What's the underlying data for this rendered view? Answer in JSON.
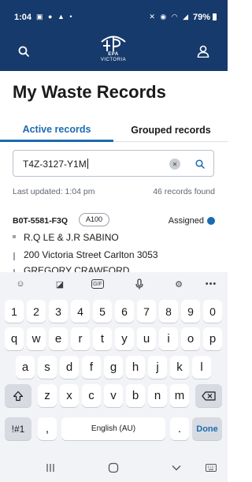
{
  "status_bar": {
    "time": "1:04",
    "battery": "79%",
    "left_icons": [
      "gallery-icon",
      "info-icon",
      "alert-icon",
      "dot-icon"
    ],
    "right_icons": [
      "mute-icon",
      "location-icon",
      "wifi-icon",
      "signal-icon"
    ]
  },
  "header": {
    "logo_line1": "EPA",
    "logo_line2": "VICTORIA",
    "brand_color": "#163a6b"
  },
  "page": {
    "title": "My Waste Records"
  },
  "tabs": [
    {
      "label": "Active records",
      "active": true
    },
    {
      "label": "Grouped records",
      "active": false
    }
  ],
  "search": {
    "value": "T4Z-3127-Y1M"
  },
  "meta": {
    "last_updated": "Last updated: 1:04 pm",
    "records_found": "46 records found"
  },
  "record": {
    "id": "B0T-5581-F3Q",
    "tag": "A100",
    "status": "Assigned",
    "lines": [
      "R.Q LE & J.R SABINO",
      "200 Victoria Street Carlton 3053",
      "GREGORY CRAWFORD"
    ]
  },
  "keyboard": {
    "row_numbers": [
      "1",
      "2",
      "3",
      "4",
      "5",
      "6",
      "7",
      "8",
      "9",
      "0"
    ],
    "row_q": [
      "q",
      "w",
      "e",
      "r",
      "t",
      "y",
      "u",
      "i",
      "o",
      "p"
    ],
    "row_a": [
      "a",
      "s",
      "d",
      "f",
      "g",
      "h",
      "j",
      "k",
      "l"
    ],
    "row_z": [
      "z",
      "x",
      "c",
      "v",
      "b",
      "n",
      "m"
    ],
    "symbols_key": "!#1",
    "comma_key": ",",
    "space_label": "English (AU)",
    "period_key": ".",
    "done_key": "Done",
    "toolbar_icons": [
      "emoji-icon",
      "sticker-icon",
      "gif-icon",
      "mic-icon",
      "settings-icon",
      "more-icon"
    ]
  },
  "accent_color": "#1c6bb0"
}
